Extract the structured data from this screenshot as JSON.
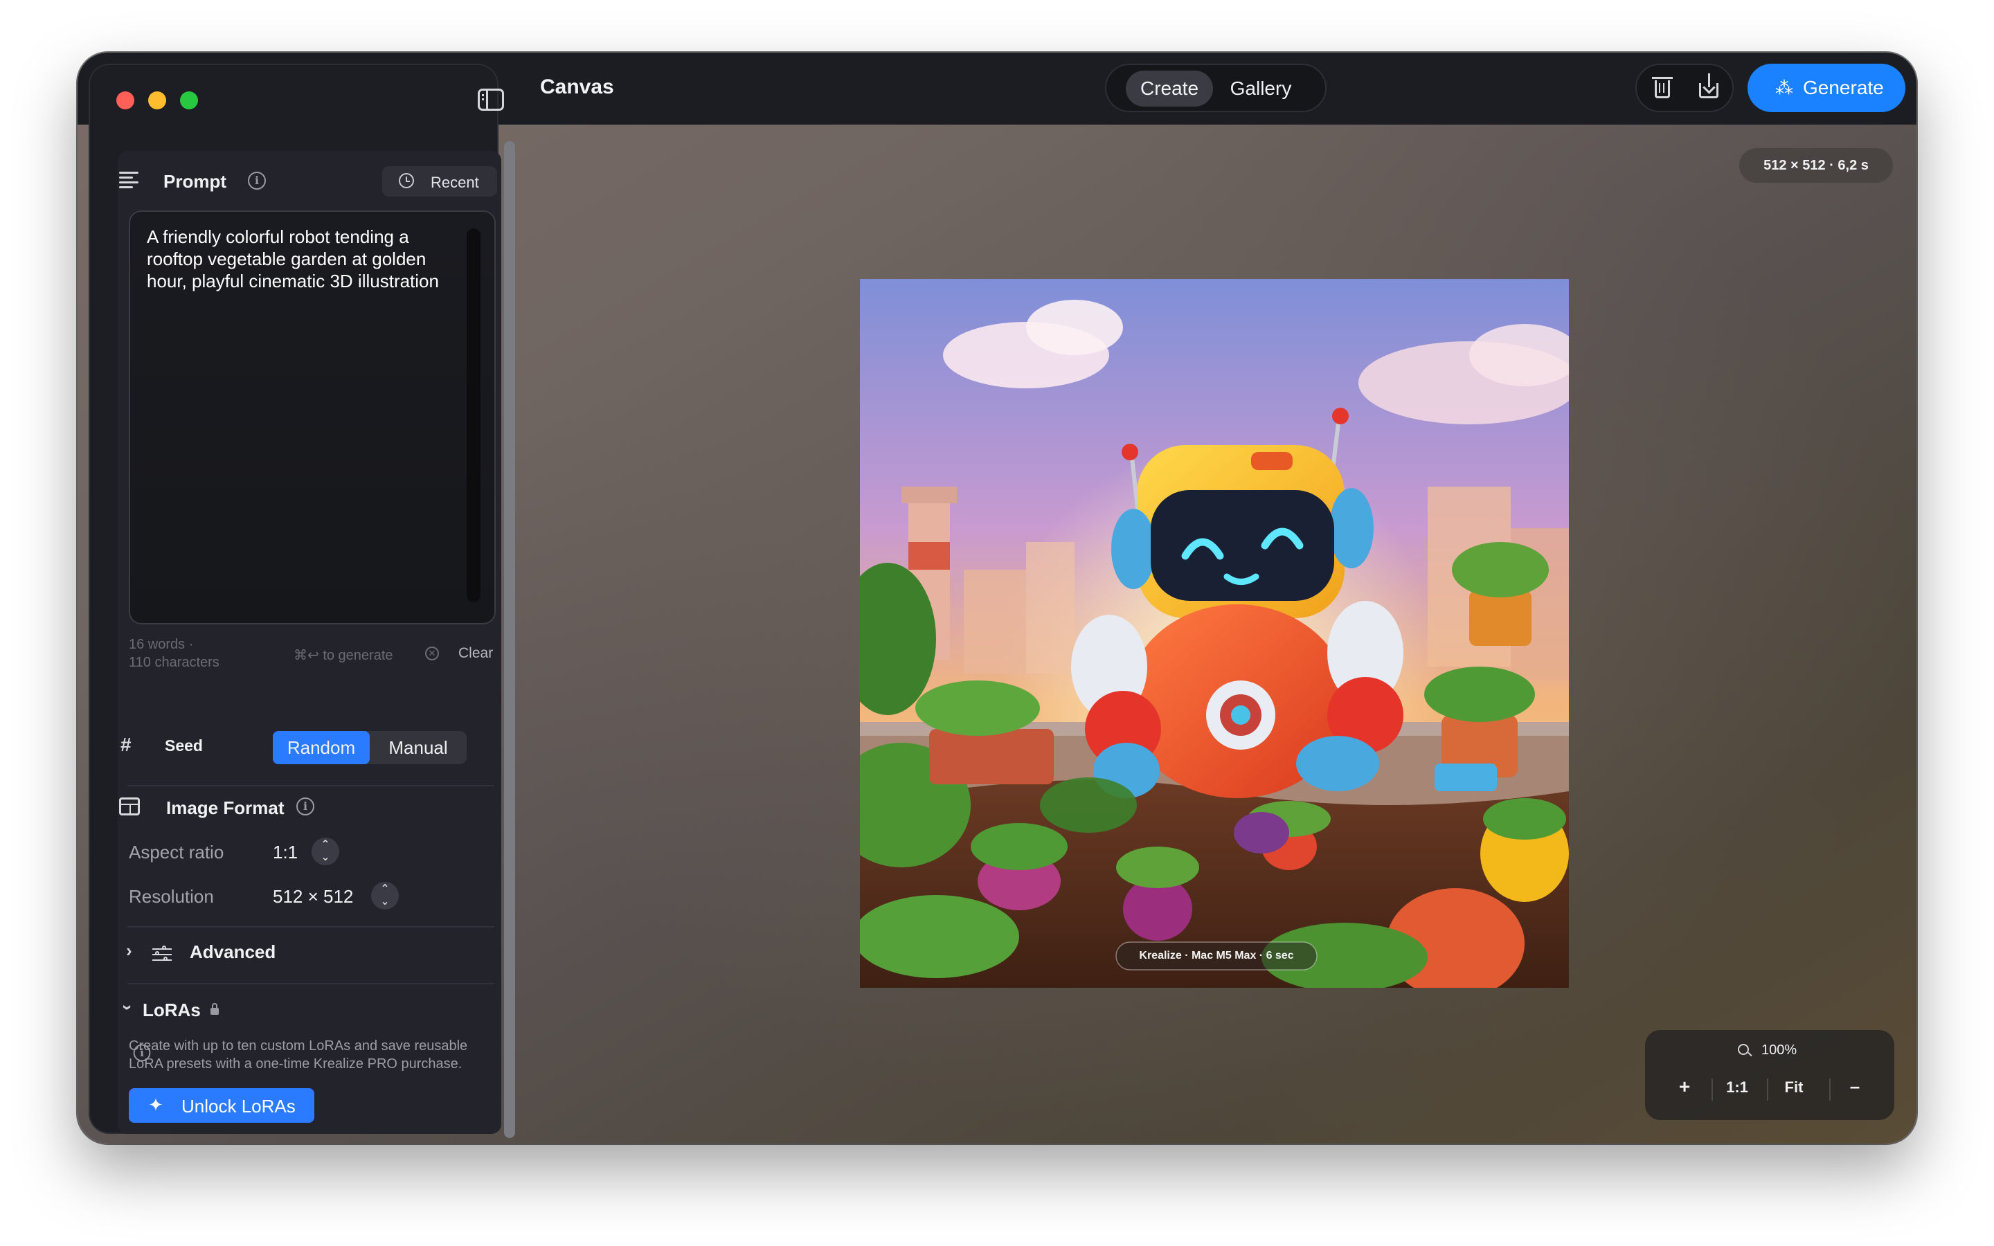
{
  "window": {
    "title": "Canvas"
  },
  "header": {
    "tabs": [
      {
        "label": "Create",
        "active": true
      },
      {
        "label": "Gallery",
        "active": false
      }
    ],
    "generate_label": "Generate",
    "accent_color": "#1a82ff"
  },
  "sidebar": {
    "prompt": {
      "title": "Prompt",
      "recent_label": "Recent",
      "text": "A friendly colorful robot tending a rooftop vegetable garden at golden hour, playful cinematic 3D illustration",
      "word_count": "16 words ·",
      "char_count": "110 characters",
      "shortcut_hint": "⌘↩ to generate",
      "clear_label": "Clear"
    },
    "seed": {
      "label": "Seed",
      "options": [
        {
          "label": "Random",
          "active": true
        },
        {
          "label": "Manual",
          "active": false
        }
      ]
    },
    "image_format": {
      "title": "Image Format",
      "aspect_ratio_label": "Aspect ratio",
      "aspect_ratio_value": "1:1",
      "resolution_label": "Resolution",
      "resolution_value": "512 × 512"
    },
    "advanced": {
      "title": "Advanced",
      "expanded": false
    },
    "loras": {
      "title": "LoRAs",
      "locked": true,
      "description": "Create with up to ten custom LoRAs and save reusable LoRA presets with a one-time Krealize PRO purchase.",
      "unlock_label": "Unlock LoRAs"
    }
  },
  "canvas": {
    "meta_badge": "512 × 512  ·  6,2 s",
    "image_caption": "Krealize · Mac M5 Max · 6 sec",
    "image_subject": "robot-garden-illustration",
    "zoom": {
      "percent": "100%",
      "zoom_in": "+",
      "actual_size": "1:1",
      "fit": "Fit",
      "zoom_out": "–"
    }
  },
  "icons": {
    "prompt": "text-lines-icon",
    "info": "info-icon",
    "recent": "clock-icon",
    "seed": "hash-icon",
    "image_format": "image-format-icon",
    "advanced": "sliders-icon",
    "loras": "lock-icon",
    "unlock": "sparkle-icon",
    "delete": "trash-icon",
    "export": "export-icon",
    "generate": "magic-wand-icon"
  }
}
